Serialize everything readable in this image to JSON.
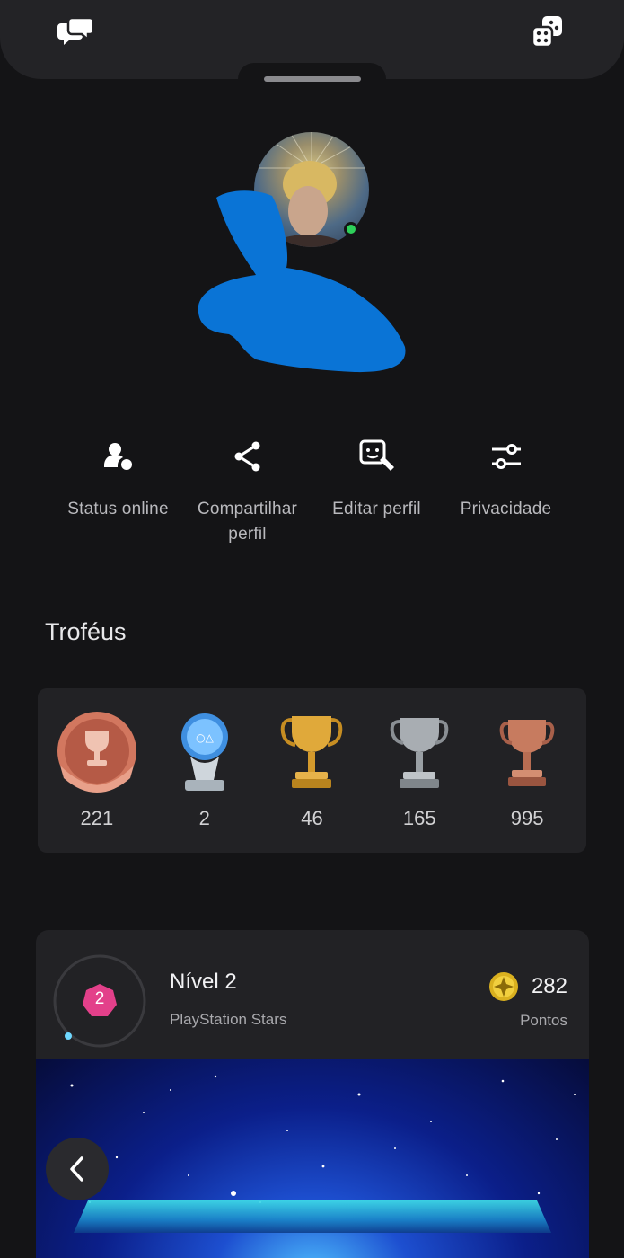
{
  "top_bar": {
    "left_icon": "chat-bubbles-icon",
    "right_icon": "game-pieces-icon"
  },
  "profile": {
    "online": true,
    "status_color": "#2ed05a"
  },
  "actions": [
    {
      "label": "Status online",
      "icon": "user-status-icon"
    },
    {
      "label": "Compartilhar perfil",
      "icon": "share-icon"
    },
    {
      "label": "Editar perfil",
      "icon": "edit-profile-icon"
    },
    {
      "label": "Privacidade",
      "icon": "sliders-icon"
    }
  ],
  "trophies": {
    "title": "Troféus",
    "items": [
      {
        "name": "trophy-level",
        "value": "221"
      },
      {
        "name": "platinum",
        "value": "2"
      },
      {
        "name": "gold",
        "value": "46"
      },
      {
        "name": "silver",
        "value": "165"
      },
      {
        "name": "bronze",
        "value": "995"
      }
    ]
  },
  "stars": {
    "level_badge": "2",
    "level_title": "Nível 2",
    "subtitle": "PlayStation Stars",
    "points": "282",
    "points_label": "Pontos"
  },
  "nav": {
    "back_icon": "chevron-left-icon"
  }
}
